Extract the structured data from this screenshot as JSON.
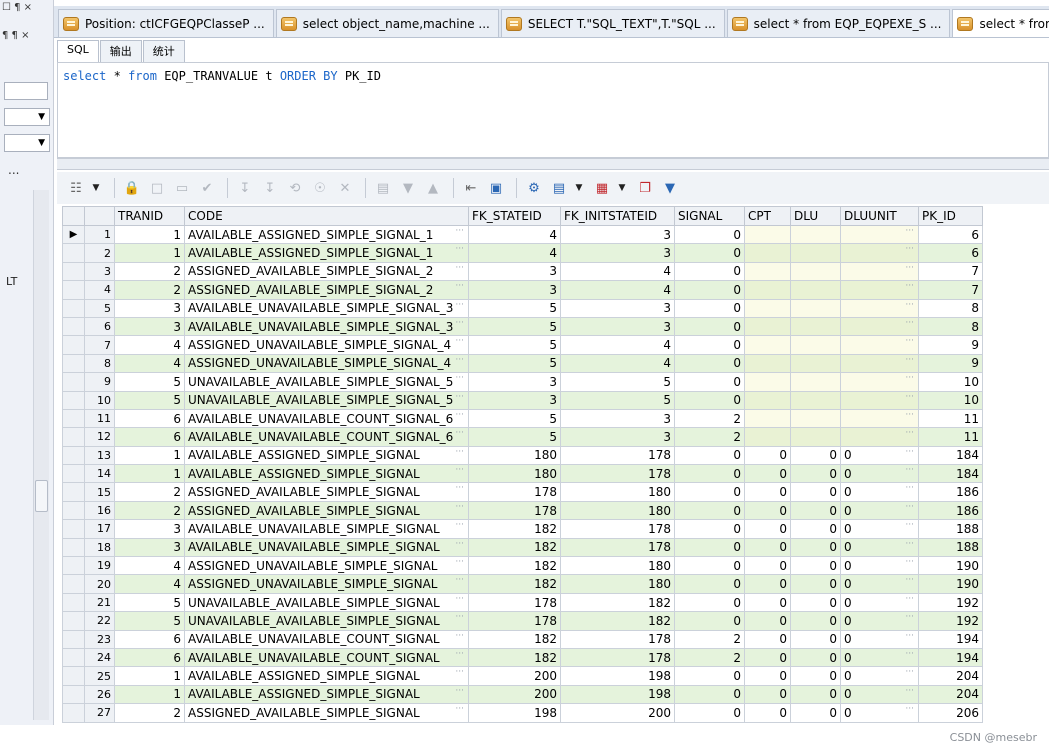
{
  "left_panel": {
    "head1": "☐ ¶ ×",
    "head2": "¶ ¶ ×",
    "dropdown_arrow": "▼",
    "more_label": "...",
    "side_label": "LT"
  },
  "tabs": [
    {
      "label": "Position: ctICFGEQPClasseP ...",
      "active": false
    },
    {
      "label": "select object_name,machine ...",
      "active": false
    },
    {
      "label": "SELECT T.\"SQL_TEXT\",T.\"SQL ...",
      "active": false
    },
    {
      "label": "select * from EQP_EQPEXE_S ...",
      "active": false
    },
    {
      "label": "select * from EQP_TRA",
      "active": true
    }
  ],
  "sub_tabs": [
    "SQL",
    "输出",
    "统计"
  ],
  "editor": {
    "kw_select": "select",
    "star": "*",
    "kw_from": "from",
    "table": "EQP_TRANVALUE",
    "alias": "t",
    "kw_order": "ORDER BY",
    "order_col": "PK_ID"
  },
  "columns": [
    "TRANID",
    "CODE",
    "FK_STATEID",
    "FK_INITSTATEID",
    "SIGNAL",
    "CPT",
    "DLU",
    "DLUUNIT",
    "PK_ID"
  ],
  "rows": [
    {
      "n": "1",
      "tranid": "1",
      "code": "AVAILABLE_ASSIGNED_SIMPLE_SIGNAL_1",
      "fk_stateid": "4",
      "fk_initstateid": "3",
      "signal": "0",
      "cpt": "",
      "dlu": "",
      "dluunit": "",
      "pk_id": "6"
    },
    {
      "n": "2",
      "tranid": "1",
      "code": "AVAILABLE_ASSIGNED_SIMPLE_SIGNAL_1",
      "fk_stateid": "4",
      "fk_initstateid": "3",
      "signal": "0",
      "cpt": "",
      "dlu": "",
      "dluunit": "",
      "pk_id": "6"
    },
    {
      "n": "3",
      "tranid": "2",
      "code": "ASSIGNED_AVAILABLE_SIMPLE_SIGNAL_2",
      "fk_stateid": "3",
      "fk_initstateid": "4",
      "signal": "0",
      "cpt": "",
      "dlu": "",
      "dluunit": "",
      "pk_id": "7"
    },
    {
      "n": "4",
      "tranid": "2",
      "code": "ASSIGNED_AVAILABLE_SIMPLE_SIGNAL_2",
      "fk_stateid": "3",
      "fk_initstateid": "4",
      "signal": "0",
      "cpt": "",
      "dlu": "",
      "dluunit": "",
      "pk_id": "7"
    },
    {
      "n": "5",
      "tranid": "3",
      "code": "AVAILABLE_UNAVAILABLE_SIMPLE_SIGNAL_3",
      "fk_stateid": "5",
      "fk_initstateid": "3",
      "signal": "0",
      "cpt": "",
      "dlu": "",
      "dluunit": "",
      "pk_id": "8"
    },
    {
      "n": "6",
      "tranid": "3",
      "code": "AVAILABLE_UNAVAILABLE_SIMPLE_SIGNAL_3",
      "fk_stateid": "5",
      "fk_initstateid": "3",
      "signal": "0",
      "cpt": "",
      "dlu": "",
      "dluunit": "",
      "pk_id": "8"
    },
    {
      "n": "7",
      "tranid": "4",
      "code": "ASSIGNED_UNAVAILABLE_SIMPLE_SIGNAL_4",
      "fk_stateid": "5",
      "fk_initstateid": "4",
      "signal": "0",
      "cpt": "",
      "dlu": "",
      "dluunit": "",
      "pk_id": "9"
    },
    {
      "n": "8",
      "tranid": "4",
      "code": "ASSIGNED_UNAVAILABLE_SIMPLE_SIGNAL_4",
      "fk_stateid": "5",
      "fk_initstateid": "4",
      "signal": "0",
      "cpt": "",
      "dlu": "",
      "dluunit": "",
      "pk_id": "9"
    },
    {
      "n": "9",
      "tranid": "5",
      "code": "UNAVAILABLE_AVAILABLE_SIMPLE_SIGNAL_5",
      "fk_stateid": "3",
      "fk_initstateid": "5",
      "signal": "0",
      "cpt": "",
      "dlu": "",
      "dluunit": "",
      "pk_id": "10"
    },
    {
      "n": "10",
      "tranid": "5",
      "code": "UNAVAILABLE_AVAILABLE_SIMPLE_SIGNAL_5",
      "fk_stateid": "3",
      "fk_initstateid": "5",
      "signal": "0",
      "cpt": "",
      "dlu": "",
      "dluunit": "",
      "pk_id": "10"
    },
    {
      "n": "11",
      "tranid": "6",
      "code": "AVAILABLE_UNAVAILABLE_COUNT_SIGNAL_6",
      "fk_stateid": "5",
      "fk_initstateid": "3",
      "signal": "2",
      "cpt": "",
      "dlu": "",
      "dluunit": "",
      "pk_id": "11"
    },
    {
      "n": "12",
      "tranid": "6",
      "code": "AVAILABLE_UNAVAILABLE_COUNT_SIGNAL_6",
      "fk_stateid": "5",
      "fk_initstateid": "3",
      "signal": "2",
      "cpt": "",
      "dlu": "",
      "dluunit": "",
      "pk_id": "11"
    },
    {
      "n": "13",
      "tranid": "1",
      "code": "AVAILABLE_ASSIGNED_SIMPLE_SIGNAL",
      "fk_stateid": "180",
      "fk_initstateid": "178",
      "signal": "0",
      "cpt": "0",
      "dlu": "0",
      "dluunit": "0",
      "pk_id": "184"
    },
    {
      "n": "14",
      "tranid": "1",
      "code": "AVAILABLE_ASSIGNED_SIMPLE_SIGNAL",
      "fk_stateid": "180",
      "fk_initstateid": "178",
      "signal": "0",
      "cpt": "0",
      "dlu": "0",
      "dluunit": "0",
      "pk_id": "184"
    },
    {
      "n": "15",
      "tranid": "2",
      "code": "ASSIGNED_AVAILABLE_SIMPLE_SIGNAL",
      "fk_stateid": "178",
      "fk_initstateid": "180",
      "signal": "0",
      "cpt": "0",
      "dlu": "0",
      "dluunit": "0",
      "pk_id": "186"
    },
    {
      "n": "16",
      "tranid": "2",
      "code": "ASSIGNED_AVAILABLE_SIMPLE_SIGNAL",
      "fk_stateid": "178",
      "fk_initstateid": "180",
      "signal": "0",
      "cpt": "0",
      "dlu": "0",
      "dluunit": "0",
      "pk_id": "186"
    },
    {
      "n": "17",
      "tranid": "3",
      "code": "AVAILABLE_UNAVAILABLE_SIMPLE_SIGNAL",
      "fk_stateid": "182",
      "fk_initstateid": "178",
      "signal": "0",
      "cpt": "0",
      "dlu": "0",
      "dluunit": "0",
      "pk_id": "188"
    },
    {
      "n": "18",
      "tranid": "3",
      "code": "AVAILABLE_UNAVAILABLE_SIMPLE_SIGNAL",
      "fk_stateid": "182",
      "fk_initstateid": "178",
      "signal": "0",
      "cpt": "0",
      "dlu": "0",
      "dluunit": "0",
      "pk_id": "188"
    },
    {
      "n": "19",
      "tranid": "4",
      "code": "ASSIGNED_UNAVAILABLE_SIMPLE_SIGNAL",
      "fk_stateid": "182",
      "fk_initstateid": "180",
      "signal": "0",
      "cpt": "0",
      "dlu": "0",
      "dluunit": "0",
      "pk_id": "190"
    },
    {
      "n": "20",
      "tranid": "4",
      "code": "ASSIGNED_UNAVAILABLE_SIMPLE_SIGNAL",
      "fk_stateid": "182",
      "fk_initstateid": "180",
      "signal": "0",
      "cpt": "0",
      "dlu": "0",
      "dluunit": "0",
      "pk_id": "190"
    },
    {
      "n": "21",
      "tranid": "5",
      "code": "UNAVAILABLE_AVAILABLE_SIMPLE_SIGNAL",
      "fk_stateid": "178",
      "fk_initstateid": "182",
      "signal": "0",
      "cpt": "0",
      "dlu": "0",
      "dluunit": "0",
      "pk_id": "192"
    },
    {
      "n": "22",
      "tranid": "5",
      "code": "UNAVAILABLE_AVAILABLE_SIMPLE_SIGNAL",
      "fk_stateid": "178",
      "fk_initstateid": "182",
      "signal": "0",
      "cpt": "0",
      "dlu": "0",
      "dluunit": "0",
      "pk_id": "192"
    },
    {
      "n": "23",
      "tranid": "6",
      "code": "AVAILABLE_UNAVAILABLE_COUNT_SIGNAL",
      "fk_stateid": "182",
      "fk_initstateid": "178",
      "signal": "2",
      "cpt": "0",
      "dlu": "0",
      "dluunit": "0",
      "pk_id": "194"
    },
    {
      "n": "24",
      "tranid": "6",
      "code": "AVAILABLE_UNAVAILABLE_COUNT_SIGNAL",
      "fk_stateid": "182",
      "fk_initstateid": "178",
      "signal": "2",
      "cpt": "0",
      "dlu": "0",
      "dluunit": "0",
      "pk_id": "194"
    },
    {
      "n": "25",
      "tranid": "1",
      "code": "AVAILABLE_ASSIGNED_SIMPLE_SIGNAL",
      "fk_stateid": "200",
      "fk_initstateid": "198",
      "signal": "0",
      "cpt": "0",
      "dlu": "0",
      "dluunit": "0",
      "pk_id": "204"
    },
    {
      "n": "26",
      "tranid": "1",
      "code": "AVAILABLE_ASSIGNED_SIMPLE_SIGNAL",
      "fk_stateid": "200",
      "fk_initstateid": "198",
      "signal": "0",
      "cpt": "0",
      "dlu": "0",
      "dluunit": "0",
      "pk_id": "204"
    },
    {
      "n": "27",
      "tranid": "2",
      "code": "ASSIGNED_AVAILABLE_SIMPLE_SIGNAL",
      "fk_stateid": "198",
      "fk_initstateid": "200",
      "signal": "0",
      "cpt": "0",
      "dlu": "0",
      "dluunit": "0",
      "pk_id": "206"
    }
  ],
  "current_row_marker": "▶",
  "cell_ellipsis": "···",
  "watermark": "CSDN @mesebr",
  "colors": {
    "row_even": "#e5f3dc",
    "keyword": "#1b66c9"
  }
}
